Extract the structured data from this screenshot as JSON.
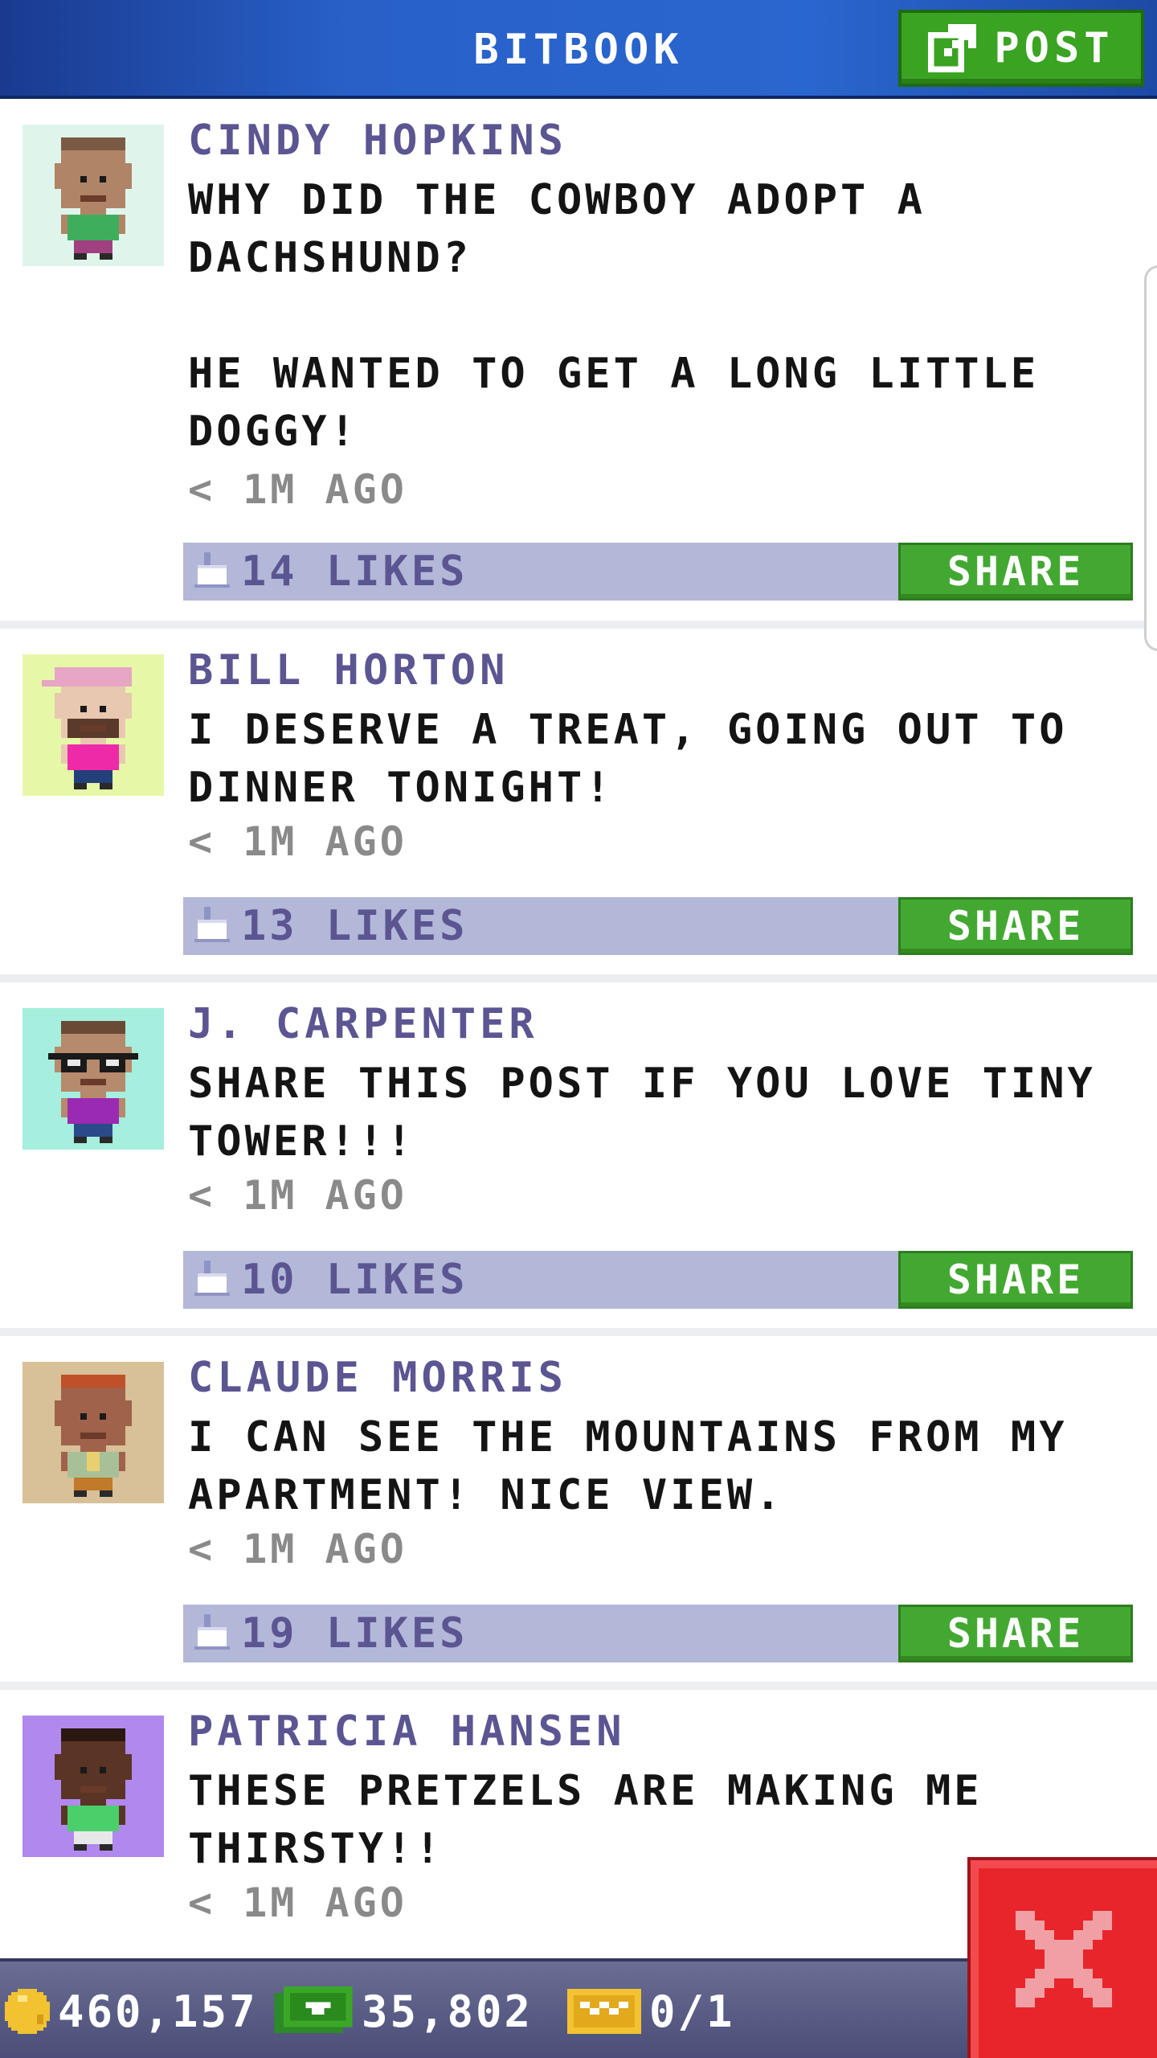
{
  "header": {
    "title": "BITBOOK",
    "post_label": "POST"
  },
  "posts": [
    {
      "name": "CINDY HOPKINS",
      "text": "WHY DID THE COWBOY ADOPT A DACHSHUND?\n\nHE WANTED TO GET A LONG LITTLE DOGGY!",
      "time": "< 1M AGO",
      "likes": "14 LIKES",
      "share_label": "SHARE",
      "avatar": {
        "bg": "#dff5ec",
        "skin": "#b08466",
        "hair": "#7a5a44",
        "shirt": "#3fae5c",
        "pants": "#a04080",
        "accessory": "none"
      }
    },
    {
      "name": "BILL HORTON",
      "text": "I DESERVE A TREAT, GOING OUT TO DINNER TONIGHT!",
      "time": "< 1M AGO",
      "likes": "13 LIKES",
      "share_label": "SHARE",
      "avatar": {
        "bg": "#e6f7a8",
        "skin": "#e8c8b0",
        "hair": "#e6a6c4",
        "shirt": "#ee2aa8",
        "pants": "#24407a",
        "accessory": "cap-beard"
      }
    },
    {
      "name": "J. CARPENTER",
      "text": "SHARE THIS POST IF YOU LOVE TINY TOWER!!!",
      "time": "< 1M AGO",
      "likes": "10 LIKES",
      "share_label": "SHARE",
      "avatar": {
        "bg": "#a6eedd",
        "skin": "#b68a6c",
        "hair": "#6a4a34",
        "shirt": "#9a2ab2",
        "pants": "#2a4a8a",
        "accessory": "glasses"
      }
    },
    {
      "name": "CLAUDE MORRIS",
      "text": "I CAN SEE THE MOUNTAINS FROM MY APARTMENT! NICE VIEW.",
      "time": "< 1M AGO",
      "likes": "19 LIKES",
      "share_label": "SHARE",
      "avatar": {
        "bg": "#d8c098",
        "skin": "#a0624a",
        "hair": "#c0502a",
        "shirt": "#a8c098",
        "pants": "#c07a2a",
        "accessory": "tie"
      }
    },
    {
      "name": "PATRICIA HANSEN",
      "text": "THESE PRETZELS ARE MAKING ME THIRSTY!!",
      "time": "< 1M AGO",
      "likes": "",
      "share_label": "",
      "avatar": {
        "bg": "#b088ee",
        "skin": "#5a3424",
        "hair": "#2a1810",
        "shirt": "#4ad06a",
        "pants": "#e8e8e8",
        "accessory": "none"
      }
    }
  ],
  "bottom_bar": {
    "coins": "460,157",
    "bux": "35,802",
    "tickets": "0/1"
  },
  "colors": {
    "header": "#2860c8",
    "post_button": "#3aa322",
    "name": "#5b5592",
    "likes_bar": "#b3b8d8",
    "share": "#43a832",
    "close": "#e8252a"
  }
}
